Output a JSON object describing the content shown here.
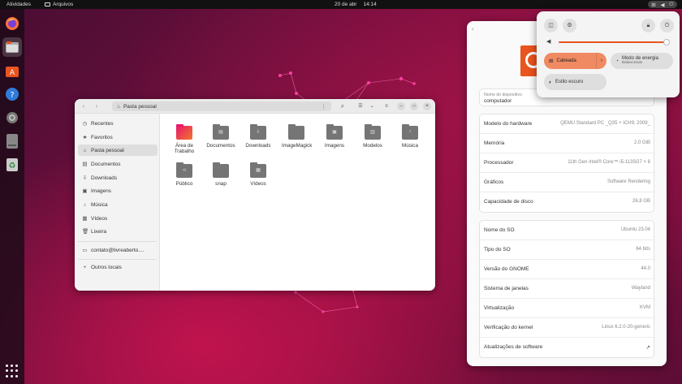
{
  "topbar": {
    "activities": "Atividades",
    "app_name": "Arquivos",
    "date": "20 de abr",
    "time": "14:14"
  },
  "files": {
    "location": "Pasta pessoal",
    "sidebar": [
      {
        "label": "Recentes",
        "icon": "clock-icon"
      },
      {
        "label": "Favoritos",
        "icon": "star-icon"
      },
      {
        "label": "Pasta pessoal",
        "icon": "home-icon",
        "selected": true
      },
      {
        "label": "Documentos",
        "icon": "document-icon"
      },
      {
        "label": "Downloads",
        "icon": "download-icon"
      },
      {
        "label": "Imagens",
        "icon": "image-icon"
      },
      {
        "label": "Música",
        "icon": "music-icon"
      },
      {
        "label": "Vídeos",
        "icon": "video-icon"
      },
      {
        "label": "Lixeira",
        "icon": "trash-icon"
      }
    ],
    "account": "contato@livreaberto....",
    "other": "Outros locais",
    "folders": [
      {
        "label": "Área de Trabalho",
        "icon": "desktop-folder-icon"
      },
      {
        "label": "Documentos",
        "icon": "document-folder-icon"
      },
      {
        "label": "Downloads",
        "icon": "download-folder-icon"
      },
      {
        "label": "ImageMagick",
        "icon": "folder-icon"
      },
      {
        "label": "Imagens",
        "icon": "image-folder-icon"
      },
      {
        "label": "Modelos",
        "icon": "template-folder-icon"
      },
      {
        "label": "Música",
        "icon": "music-folder-icon"
      },
      {
        "label": "Público",
        "icon": "share-folder-icon"
      },
      {
        "label": "snap",
        "icon": "folder-icon"
      },
      {
        "label": "Vídeos",
        "icon": "video-folder-icon"
      }
    ]
  },
  "settings": {
    "device_name_label": "Nome do dispositivo",
    "device_name": "computador",
    "hardware": [
      {
        "k": "Modelo do hardware",
        "v": "QEMU Standard PC _Q35 + ICH9, 2009_"
      },
      {
        "k": "Memória",
        "v": "2,0 GiB"
      },
      {
        "k": "Processador",
        "v": "11th Gen Intel® Core™ i5-1135G7 × 8"
      },
      {
        "k": "Gráficos",
        "v": "Software Rendering"
      },
      {
        "k": "Capacidade de disco",
        "v": "26,8 GB"
      }
    ],
    "software": [
      {
        "k": "Nome do SO",
        "v": "Ubuntu 23.04"
      },
      {
        "k": "Tipo do SO",
        "v": "64 bits"
      },
      {
        "k": "Versão do GNOME",
        "v": "44.0"
      },
      {
        "k": "Sistema de janelas",
        "v": "Wayland"
      },
      {
        "k": "Virtualização",
        "v": "KVM"
      },
      {
        "k": "Verificação do kernel",
        "v": "Linux 6.2.0-20-generic"
      },
      {
        "k": "Atualizações de software",
        "v": ""
      }
    ]
  },
  "quick_settings": {
    "volume": 0.97,
    "wired": "Cabeada",
    "power_mode": "Modo de energia",
    "power_mode_sub": "Balanceado",
    "dark_style": "Estilo escuro"
  },
  "colors": {
    "accent": "#e95420",
    "panel": "#111111"
  }
}
